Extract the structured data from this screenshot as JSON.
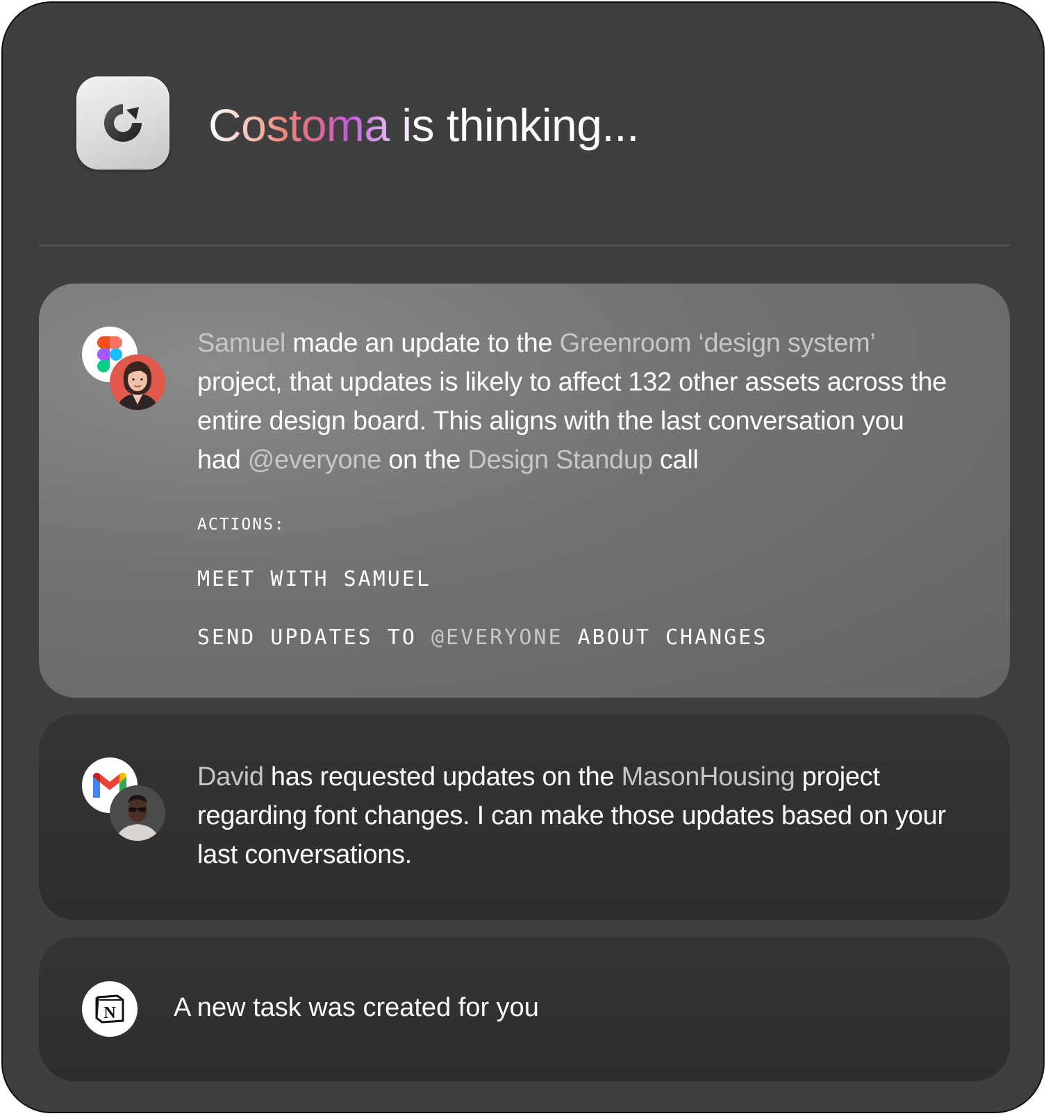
{
  "header": {
    "title": "Costoma is thinking...",
    "app_icon": "costoma-logo-icon"
  },
  "cards": [
    {
      "source_icon": "figma-icon",
      "avatar": "samuel-avatar",
      "message": {
        "person": "Samuel",
        "t1": " made an update to the ",
        "project": "Greenroom ‘design system’",
        "t2": " project, that updates is likely to affect 132 other assets across the entire design board. This aligns with the last conversation you had ",
        "mention": "@everyone",
        "t3": " on the ",
        "meeting": "Design Standup",
        "t4": " call"
      },
      "actions_label": "ACTIONS:",
      "actions": [
        {
          "text": "MEET WITH SAMUEL"
        },
        {
          "pre": "SEND UPDATES TO ",
          "mention": "@EVERYONE",
          "post": " ABOUT CHANGES"
        }
      ]
    },
    {
      "source_icon": "gmail-icon",
      "avatar": "david-avatar",
      "message": {
        "person": "David",
        "t1": " has requested updates on the ",
        "project": "MasonHousing",
        "t2": " project regarding font changes. I can make those updates based on your last conversations."
      }
    },
    {
      "source_icon": "notion-icon",
      "message": "A new task was created for you"
    }
  ],
  "colors": {
    "panel_bg": "#3f3f3f",
    "card_highlight": "#727272",
    "card_dark": "#313131",
    "muted_text": "#c6c6c6",
    "gradient": [
      "#f4cfc6",
      "#ee8a7c",
      "#c35ad6",
      "#d9a5ea"
    ]
  }
}
